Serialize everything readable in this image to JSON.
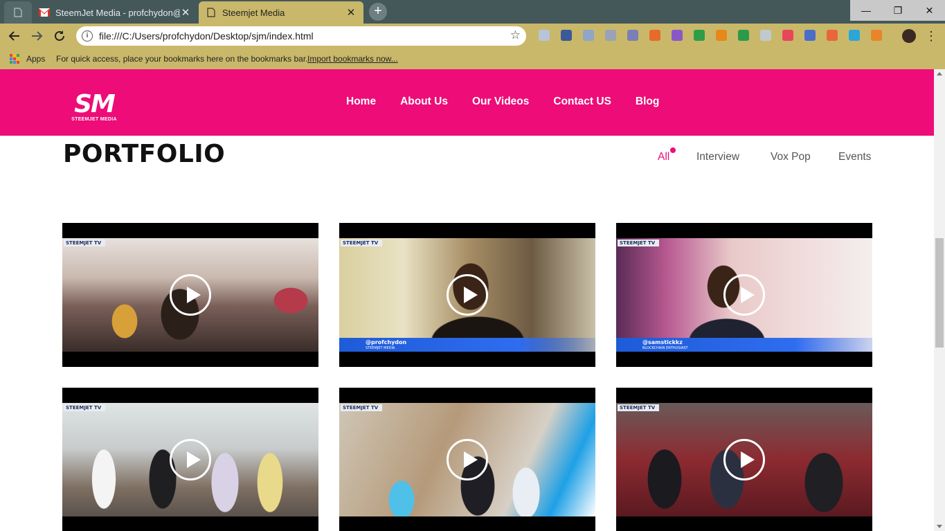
{
  "browser": {
    "tabs": [
      {
        "title": "SteemJet Media - profchydon@g",
        "icon": "gmail-icon"
      },
      {
        "title": "Steemjet Media",
        "icon": "file-icon",
        "active": true
      }
    ],
    "new_tab": "+",
    "close_glyph": "✕",
    "window_controls": {
      "minimize": "—",
      "maximize": "❐",
      "close": "✕"
    },
    "url": "file:///C:/Users/profchydon/Desktop/sjm/index.html",
    "info_glyph": "i",
    "bookmarks": {
      "apps_label": "Apps",
      "hint": "For quick access, place your bookmarks here on the bookmarks bar.",
      "import_link": "Import bookmarks now..."
    },
    "extension_colors": [
      "#b8c4d8",
      "#3b5998",
      "#8fa6c8",
      "#9aa3b5",
      "#7a7fb5",
      "#e86a2a",
      "#8a57c8",
      "#2f9d48",
      "#e8881a",
      "#2b9a4a",
      "#c0c8d0",
      "#e8465a",
      "#4a6ec8",
      "#e8663a",
      "#2aa7d8",
      "#e8852a"
    ]
  },
  "site": {
    "logo_mark": "SM",
    "logo_sub": "STEEMJET MEDIA",
    "nav": [
      "Home",
      "About Us",
      "Our Videos",
      "Contact US",
      "Blog"
    ],
    "accent_color": "#ed0c78"
  },
  "portfolio": {
    "title": "PORTFOLIO",
    "filters": [
      "All",
      "Interview",
      "Vox Pop",
      "Events"
    ],
    "active_filter": "All",
    "videos": [
      {
        "badge": "STEEMJET TV",
        "scene": "audience seated in a hall"
      },
      {
        "badge": "STEEMJET TV",
        "scene": "man in dark shirt interview",
        "handle": "@profchydon",
        "role": "STEEMJET MEDIA"
      },
      {
        "badge": "STEEMJET TV",
        "scene": "man in suit interview",
        "handle": "@samstickkz",
        "role": "BLOCKCHAIN ENTHUSIAST"
      },
      {
        "badge": "STEEMJET TV",
        "scene": "group interview outdoors"
      },
      {
        "badge": "STEEMJET TV",
        "scene": "students waving at camera"
      },
      {
        "badge": "STEEMJET TV",
        "scene": "people seated on red chairs"
      }
    ]
  }
}
